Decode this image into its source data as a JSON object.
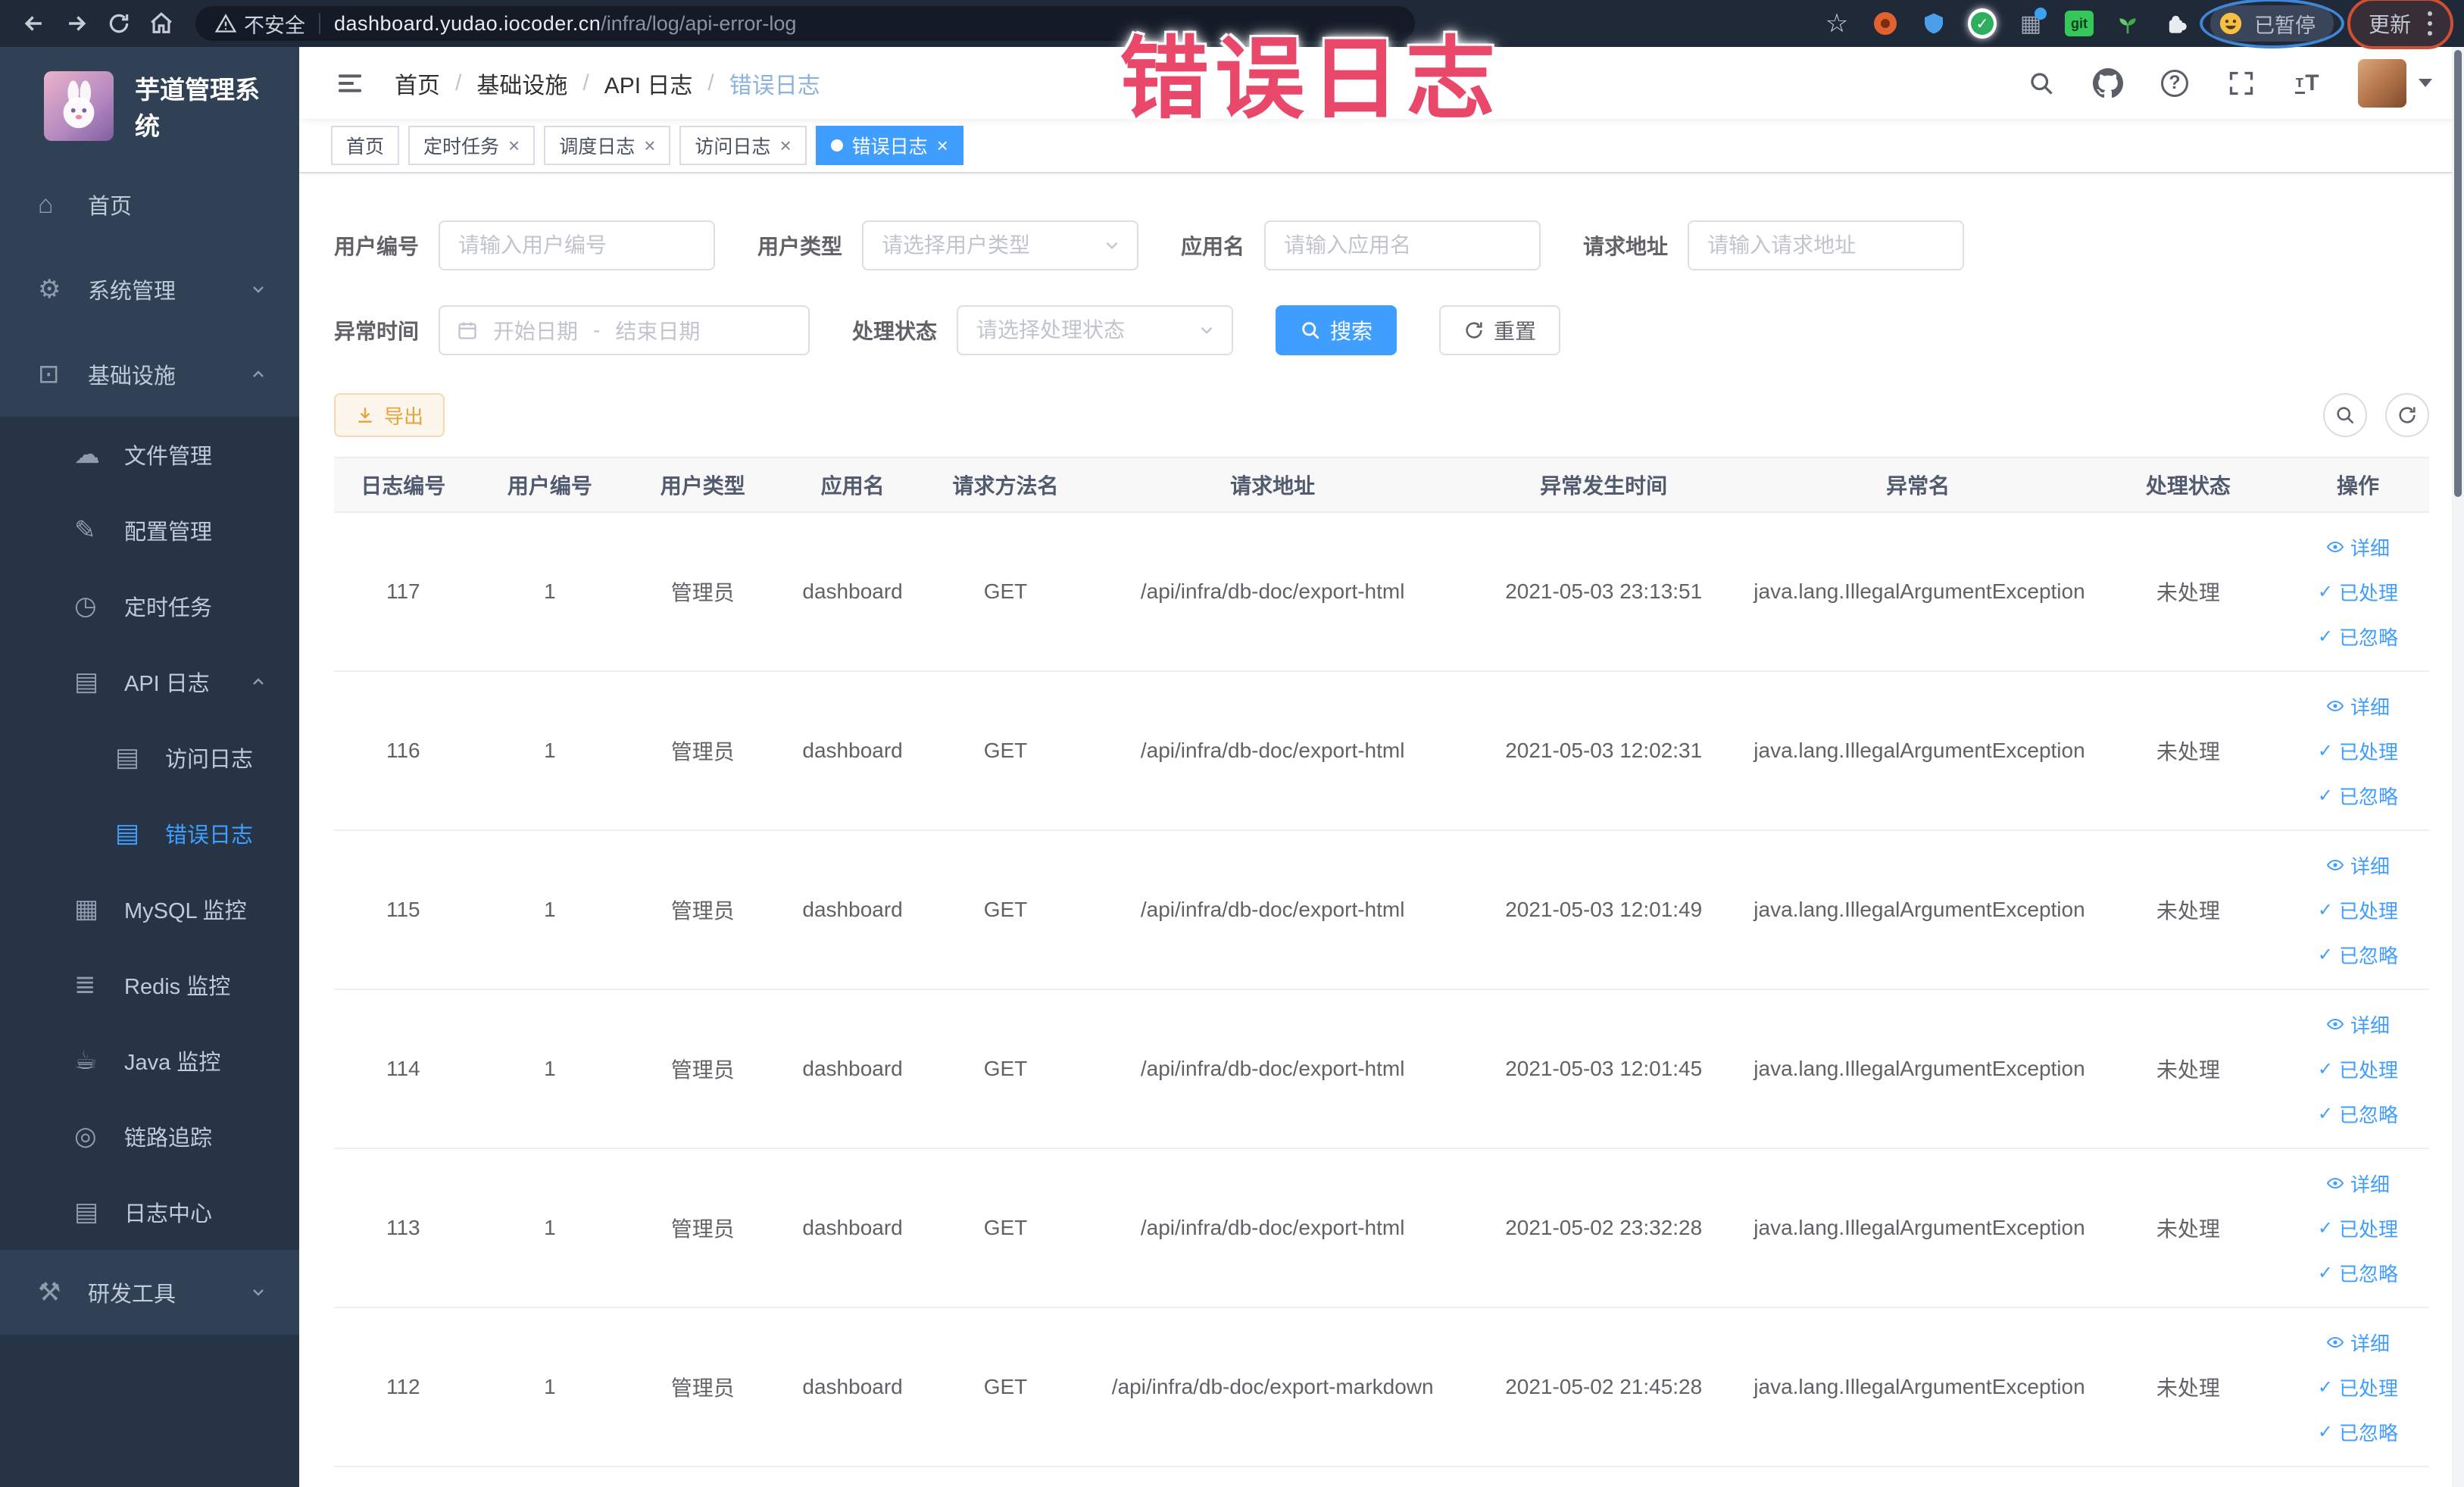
{
  "browser": {
    "security_label": "不安全",
    "url_host": "dashboard.yudao.iocoder.cn",
    "url_path": "/infra/log/api-error-log",
    "git_badge": "git",
    "paused_label": "已暂停",
    "update_label": "更新"
  },
  "overlay": {
    "title": "错误日志",
    "color": "#e9486b"
  },
  "icons": {
    "home": "⌂",
    "gear": "⚙",
    "monitor": "⊡",
    "cloud": "☁",
    "edit": "✎",
    "timer": "◷",
    "log": "▤",
    "chart": "▦",
    "layers": "≣",
    "java": "☕",
    "trace": "◎",
    "tools": "⚒",
    "check": "✓",
    "close": "×",
    "star": "☆",
    "grid": "▦",
    "font_small": "т",
    "font_big": "T",
    "question": "?"
  },
  "sidebar": {
    "logo_title": "芋道管理系统",
    "home": "首页",
    "system": "系统管理",
    "infra": "基础设施",
    "file": "文件管理",
    "config": "配置管理",
    "job": "定时任务",
    "api_log": "API 日志",
    "access_log": "访问日志",
    "error_log": "错误日志",
    "mysql": "MySQL 监控",
    "redis": "Redis 监控",
    "java": "Java 监控",
    "trace": "链路追踪",
    "log_center": "日志中心",
    "dev_tools": "研发工具"
  },
  "breadcrumb": [
    "首页",
    "基础设施",
    "API 日志",
    "错误日志"
  ],
  "tabs": [
    {
      "label": "首页"
    },
    {
      "label": "定时任务"
    },
    {
      "label": "调度日志"
    },
    {
      "label": "访问日志"
    },
    {
      "label": "错误日志"
    }
  ],
  "filters": {
    "user_id_label": "用户编号",
    "user_id_placeholder": "请输入用户编号",
    "user_type_label": "用户类型",
    "user_type_placeholder": "请选择用户类型",
    "app_name_label": "应用名",
    "app_name_placeholder": "请输入应用名",
    "request_url_label": "请求地址",
    "request_url_placeholder": "请输入请求地址",
    "exception_time_label": "异常时间",
    "start_date_placeholder": "开始日期",
    "end_date_placeholder": "结束日期",
    "range_separator": "-",
    "process_status_label": "处理状态",
    "process_status_placeholder": "请选择处理状态",
    "search_label": "搜索",
    "reset_label": "重置"
  },
  "toolbar": {
    "export_label": "导出"
  },
  "table": {
    "columns": [
      "日志编号",
      "用户编号",
      "用户类型",
      "应用名",
      "请求方法名",
      "请求地址",
      "异常发生时间",
      "异常名",
      "处理状态",
      "操作"
    ],
    "actions": {
      "detail": "详细",
      "processed": "已处理",
      "ignored": "已忽略"
    },
    "rows": [
      {
        "id": "117",
        "user_id": "1",
        "user_type": "管理员",
        "app": "dashboard",
        "method": "GET",
        "url": "/api/infra/db-doc/export-html",
        "time": "2021-05-03 23:13:51",
        "exception": "java.lang.IllegalArgumentException",
        "status": "未处理"
      },
      {
        "id": "116",
        "user_id": "1",
        "user_type": "管理员",
        "app": "dashboard",
        "method": "GET",
        "url": "/api/infra/db-doc/export-html",
        "time": "2021-05-03 12:02:31",
        "exception": "java.lang.IllegalArgumentException",
        "status": "未处理"
      },
      {
        "id": "115",
        "user_id": "1",
        "user_type": "管理员",
        "app": "dashboard",
        "method": "GET",
        "url": "/api/infra/db-doc/export-html",
        "time": "2021-05-03 12:01:49",
        "exception": "java.lang.IllegalArgumentException",
        "status": "未处理"
      },
      {
        "id": "114",
        "user_id": "1",
        "user_type": "管理员",
        "app": "dashboard",
        "method": "GET",
        "url": "/api/infra/db-doc/export-html",
        "time": "2021-05-03 12:01:45",
        "exception": "java.lang.IllegalArgumentException",
        "status": "未处理"
      },
      {
        "id": "113",
        "user_id": "1",
        "user_type": "管理员",
        "app": "dashboard",
        "method": "GET",
        "url": "/api/infra/db-doc/export-html",
        "time": "2021-05-02 23:32:28",
        "exception": "java.lang.IllegalArgumentException",
        "status": "未处理"
      },
      {
        "id": "112",
        "user_id": "1",
        "user_type": "管理员",
        "app": "dashboard",
        "method": "GET",
        "url": "/api/infra/db-doc/export-markdown",
        "time": "2021-05-02 21:45:28",
        "exception": "java.lang.IllegalArgumentException",
        "status": "未处理"
      }
    ]
  },
  "colors": {
    "accent": "#409eff",
    "warning": "#e6a23c",
    "sidebar_bg": "#304156",
    "sidebar_sub_bg": "#263445",
    "overlay_pink": "#e9486b"
  }
}
